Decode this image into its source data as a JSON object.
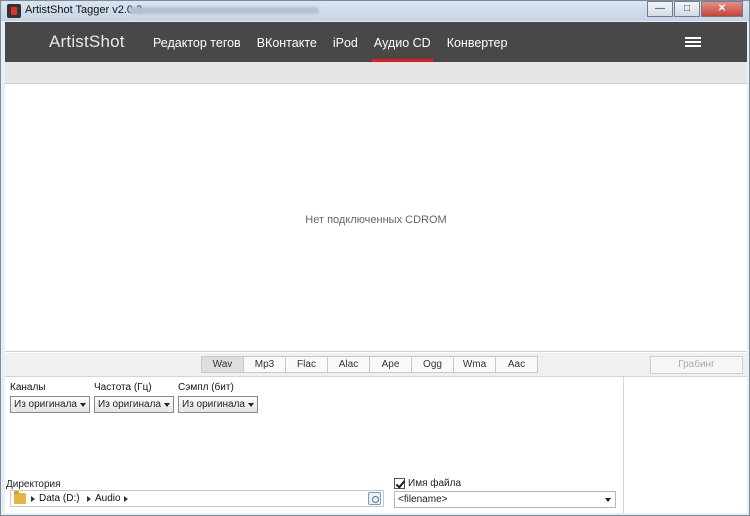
{
  "window": {
    "title": "ArtistShot Tagger v2.0.3",
    "minimize": "—",
    "maximize": "□",
    "close": "✕"
  },
  "navbar": {
    "brand": "ArtistShot",
    "items": [
      {
        "label": "Редактор тегов"
      },
      {
        "label": "ВКонтакте"
      },
      {
        "label": "iPod"
      },
      {
        "label": "Аудио CD",
        "active": true
      },
      {
        "label": "Конвертер"
      }
    ],
    "accent_color": "#e02020"
  },
  "content": {
    "empty_message": "Нет подключенных CDROM"
  },
  "formats": {
    "items": [
      "Wav",
      "Mp3",
      "Flac",
      "Alac",
      "Ape",
      "Ogg",
      "Wma",
      "Aac"
    ],
    "selected": "Wav",
    "grab_button": "Грабинг"
  },
  "params": {
    "channels": {
      "label": "Каналы",
      "value": "Из оригинала"
    },
    "frequency": {
      "label": "Частота (Гц)",
      "value": "Из оригинала"
    },
    "sample": {
      "label": "Сэмпл (бит)",
      "value": "Из оригинала"
    }
  },
  "directory": {
    "label": "Директория",
    "crumbs": [
      "Data (D:)",
      "Audio"
    ]
  },
  "filename": {
    "checked": true,
    "label": "Имя файла",
    "value": "<filename>"
  },
  "icons": [
    "app-icon",
    "menu-icon",
    "folder-icon",
    "browse-icon",
    "dropdown-arrow-icon",
    "checkbox-icon"
  ]
}
